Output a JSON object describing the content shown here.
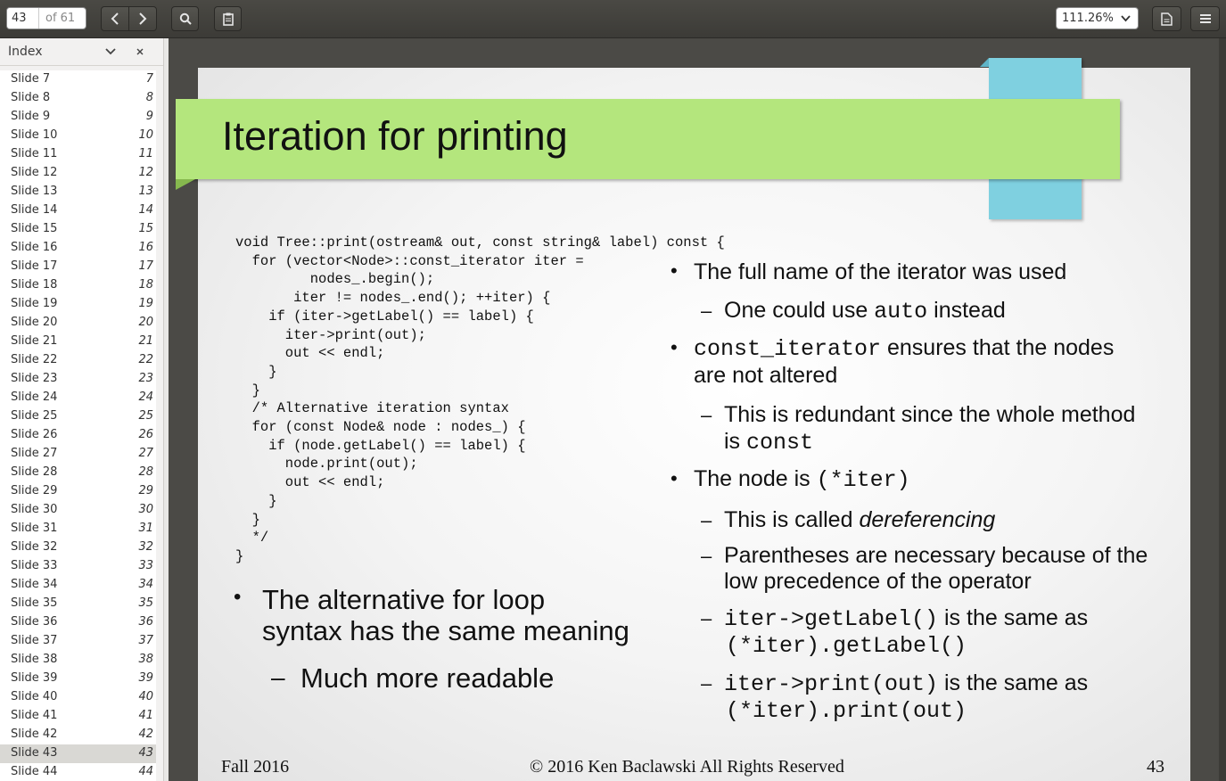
{
  "toolbar": {
    "current_page": "43",
    "page_total": "of 61",
    "zoom": "111.26%"
  },
  "sidebar": {
    "title": "Index",
    "items": [
      {
        "label": "Slide 7",
        "page": "7"
      },
      {
        "label": "Slide 8",
        "page": "8"
      },
      {
        "label": "Slide 9",
        "page": "9"
      },
      {
        "label": "Slide 10",
        "page": "10"
      },
      {
        "label": "Slide 11",
        "page": "11"
      },
      {
        "label": "Slide 12",
        "page": "12"
      },
      {
        "label": "Slide 13",
        "page": "13"
      },
      {
        "label": "Slide 14",
        "page": "14"
      },
      {
        "label": "Slide 15",
        "page": "15"
      },
      {
        "label": "Slide 16",
        "page": "16"
      },
      {
        "label": "Slide 17",
        "page": "17"
      },
      {
        "label": "Slide 18",
        "page": "18"
      },
      {
        "label": "Slide 19",
        "page": "19"
      },
      {
        "label": "Slide 20",
        "page": "20"
      },
      {
        "label": "Slide 21",
        "page": "21"
      },
      {
        "label": "Slide 22",
        "page": "22"
      },
      {
        "label": "Slide 23",
        "page": "23"
      },
      {
        "label": "Slide 24",
        "page": "24"
      },
      {
        "label": "Slide 25",
        "page": "25"
      },
      {
        "label": "Slide 26",
        "page": "26"
      },
      {
        "label": "Slide 27",
        "page": "27"
      },
      {
        "label": "Slide 28",
        "page": "28"
      },
      {
        "label": "Slide 29",
        "page": "29"
      },
      {
        "label": "Slide 30",
        "page": "30"
      },
      {
        "label": "Slide 31",
        "page": "31"
      },
      {
        "label": "Slide 32",
        "page": "32"
      },
      {
        "label": "Slide 33",
        "page": "33"
      },
      {
        "label": "Slide 34",
        "page": "34"
      },
      {
        "label": "Slide 35",
        "page": "35"
      },
      {
        "label": "Slide 36",
        "page": "36"
      },
      {
        "label": "Slide 37",
        "page": "37"
      },
      {
        "label": "Slide 38",
        "page": "38"
      },
      {
        "label": "Slide 39",
        "page": "39"
      },
      {
        "label": "Slide 40",
        "page": "40"
      },
      {
        "label": "Slide 41",
        "page": "41"
      },
      {
        "label": "Slide 42",
        "page": "42"
      },
      {
        "label": "Slide 43",
        "page": "43",
        "selected": true
      },
      {
        "label": "Slide 44",
        "page": "44"
      }
    ]
  },
  "slide": {
    "title": "Iteration for printing",
    "code": "void Tree::print(ostream& out, const string& label) const {\n  for (vector<Node>::const_iterator iter =\n         nodes_.begin();\n       iter != nodes_.end(); ++iter) {\n    if (iter->getLabel() == label) {\n      iter->print(out);\n      out << endl;\n    }\n  }\n  /* Alternative iteration syntax\n  for (const Node& node : nodes_) {\n    if (node.getLabel() == label) {\n      node.print(out);\n      out << endl;\n    }\n  }\n  */\n}",
    "left_bullet": {
      "line1": "The alternative for loop",
      "line2": "syntax has the same meaning"
    },
    "left_sub": "Much more readable",
    "b1": "The full name of the iterator was used",
    "b1_sub": {
      "pre": "One could use ",
      "code": "auto",
      "post": " instead"
    },
    "b2": {
      "code": "const_iterator",
      "post": " ensures that the nodes",
      "line2": "are not altered"
    },
    "b2_sub": {
      "line1": "This is redundant since the whole method",
      "pre2": "is ",
      "code2": "const"
    },
    "b3": {
      "pre": "The node is ",
      "code": "(*iter)"
    },
    "b3_sub1": {
      "pre": "This is called ",
      "em": "dereferencing"
    },
    "b3_sub2": {
      "line1": "Parentheses are necessary because of the",
      "line2": "low precedence of the operator"
    },
    "b3_sub3": {
      "code1": "iter->getLabel()",
      "mid": " is the same as",
      "code2": "(*iter).getLabel()"
    },
    "b3_sub4": {
      "code1": "iter->print(out)",
      "mid": " is the same as",
      "code2": "(*iter).print(out)"
    },
    "bullet_char": "•",
    "dash_char": "–",
    "footer_left": "Fall 2016",
    "footer_center": "© 2016 Ken Baclawski All Rights Reserved",
    "footer_page": "43",
    "colors": {
      "title_bar": "#b4e67d",
      "accent_block": "#7fd0e0"
    }
  }
}
